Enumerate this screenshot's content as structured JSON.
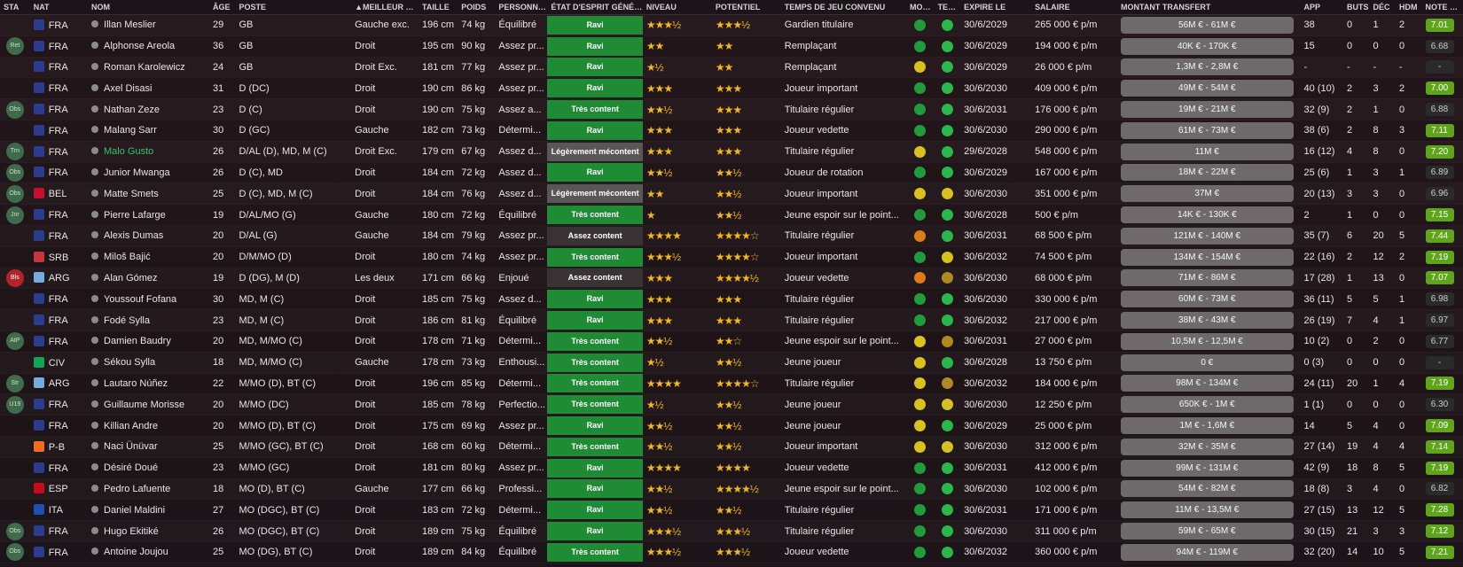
{
  "headers": [
    "STA",
    "NAT",
    "NOM",
    "ÂGE",
    "POSTE",
    "▲MEILLEUR PIED",
    "TAILLE",
    "POIDS",
    "PERSONNAL...",
    "ÉTAT D'ESPRIT GÉNÉRAL",
    "NIVEAU",
    "POTENTIEL",
    "TEMPS DE JEU CONVENU",
    "MOR...",
    "TEMP...",
    "EXPIRE LE",
    "SALAIRE",
    "MONTANT TRANSFERT",
    "APP",
    "BUTS",
    "DÉC",
    "HDM",
    "NOTE MOY"
  ],
  "rows": [
    {
      "sta": "",
      "nat": "FRA",
      "flag": "fra",
      "name": "Illan Meslier",
      "age": "29",
      "pos": "GB",
      "foot": "Gauche exc.",
      "height": "196 cm",
      "weight": "74 kg",
      "pers": "Équilibré",
      "mood": "Ravi",
      "moodc": "green",
      "niv": "★★★½",
      "pot": "★★★½",
      "pt": "Gardien titulaire",
      "morc": "g",
      "tempc": "g",
      "exp": "30/6/2029",
      "sal": "265 000 € p/m",
      "tv": "56M € - 61M €",
      "app": "38",
      "buts": "0",
      "dec": "1",
      "hdm": "2",
      "note": "7.01",
      "noteg": true
    },
    {
      "sta": "Ret",
      "nat": "FRA",
      "flag": "fra",
      "name": "Alphonse Areola",
      "age": "36",
      "pos": "GB",
      "foot": "Droit",
      "height": "195 cm",
      "weight": "90 kg",
      "pers": "Assez pr...",
      "mood": "Ravi",
      "moodc": "green",
      "niv": "★★",
      "pot": "★★",
      "pt": "Remplaçant",
      "morc": "g",
      "tempc": "g",
      "exp": "30/6/2029",
      "sal": "194 000 € p/m",
      "tv": "40K € - 170K €",
      "app": "15",
      "buts": "0",
      "dec": "0",
      "hdm": "0",
      "note": "6.68",
      "noteg": false
    },
    {
      "sta": "",
      "nat": "FRA",
      "flag": "fra",
      "name": "Roman Karolewicz",
      "age": "24",
      "pos": "GB",
      "foot": "Droit Exc.",
      "height": "181 cm",
      "weight": "77 kg",
      "pers": "Assez pr...",
      "mood": "Ravi",
      "moodc": "green",
      "niv": "★½",
      "pot": "★★",
      "pt": "Remplaçant",
      "morc": "y",
      "tempc": "g",
      "exp": "30/6/2029",
      "sal": "26 000 € p/m",
      "tv": "1,3M € - 2,8M €",
      "app": "-",
      "buts": "-",
      "dec": "-",
      "hdm": "-",
      "note": "-",
      "noteg": false
    },
    {
      "sta": "",
      "nat": "FRA",
      "flag": "fra",
      "name": "Axel Disasi",
      "age": "31",
      "pos": "D (DC)",
      "foot": "Droit",
      "height": "190 cm",
      "weight": "86 kg",
      "pers": "Assez pr...",
      "mood": "Ravi",
      "moodc": "green",
      "niv": "★★★",
      "pot": "★★★",
      "pt": "Joueur important",
      "morc": "g",
      "tempc": "g",
      "exp": "30/6/2030",
      "sal": "409 000 € p/m",
      "tv": "49M € - 54M €",
      "app": "40 (10)",
      "buts": "2",
      "dec": "3",
      "hdm": "2",
      "note": "7.00",
      "noteg": true
    },
    {
      "sta": "Obs",
      "nat": "FRA",
      "flag": "fra",
      "name": "Nathan Zeze",
      "age": "23",
      "pos": "D (C)",
      "foot": "Droit",
      "height": "190 cm",
      "weight": "75 kg",
      "pers": "Assez a...",
      "mood": "Très content",
      "moodc": "green",
      "niv": "★★½",
      "pot": "★★★",
      "pt": "Titulaire régulier",
      "morc": "g",
      "tempc": "g",
      "exp": "30/6/2031",
      "sal": "176 000 € p/m",
      "tv": "19M € - 21M €",
      "app": "32 (9)",
      "buts": "2",
      "dec": "1",
      "hdm": "0",
      "note": "6.88",
      "noteg": false
    },
    {
      "sta": "",
      "nat": "FRA",
      "flag": "fra",
      "name": "Malang Sarr",
      "age": "30",
      "pos": "D (GC)",
      "foot": "Gauche",
      "height": "182 cm",
      "weight": "73 kg",
      "pers": "Détermi...",
      "mood": "Ravi",
      "moodc": "green",
      "niv": "★★★",
      "pot": "★★★",
      "pt": "Joueur vedette",
      "morc": "g",
      "tempc": "g",
      "exp": "30/6/2030",
      "sal": "290 000 € p/m",
      "tv": "61M € - 73M €",
      "app": "38 (6)",
      "buts": "2",
      "dec": "8",
      "hdm": "3",
      "note": "7.11",
      "noteg": true
    },
    {
      "sta": "Trn",
      "nat": "FRA",
      "flag": "fra",
      "name": "Malo Gusto",
      "age": "26",
      "pos": "D/AL (D), MD, M (C)",
      "foot": "Droit Exc.",
      "height": "179 cm",
      "weight": "67 kg",
      "pers": "Assez d...",
      "mood": "Légèrement mécontent",
      "moodc": "grey",
      "niv": "★★★",
      "pot": "★★★",
      "pt": "Titulaire régulier",
      "morc": "y",
      "tempc": "g",
      "exp": "29/6/2028",
      "sal": "548 000 € p/m",
      "tv": "11M €",
      "app": "16 (12)",
      "buts": "4",
      "dec": "8",
      "hdm": "0",
      "note": "7.20",
      "noteg": true,
      "green": true
    },
    {
      "sta": "Obs",
      "nat": "FRA",
      "flag": "fra",
      "name": "Junior Mwanga",
      "age": "26",
      "pos": "D (C), MD",
      "foot": "Droit",
      "height": "184 cm",
      "weight": "72 kg",
      "pers": "Assez d...",
      "mood": "Ravi",
      "moodc": "green",
      "niv": "★★½",
      "pot": "★★½",
      "pt": "Joueur de rotation",
      "morc": "g",
      "tempc": "g",
      "exp": "30/6/2029",
      "sal": "167 000 € p/m",
      "tv": "18M € - 22M €",
      "app": "25 (6)",
      "buts": "1",
      "dec": "3",
      "hdm": "1",
      "note": "6.89",
      "noteg": false
    },
    {
      "sta": "Obs",
      "nat": "BEL",
      "flag": "bel",
      "name": "Matte Smets",
      "age": "25",
      "pos": "D (C), MD, M (C)",
      "foot": "Droit",
      "height": "184 cm",
      "weight": "76 kg",
      "pers": "Assez d...",
      "mood": "Légèrement mécontent",
      "moodc": "grey",
      "niv": "★★",
      "pot": "★★½",
      "pt": "Joueur important",
      "morc": "y",
      "tempc": "y",
      "exp": "30/6/2030",
      "sal": "351 000 € p/m",
      "tv": "37M €",
      "app": "20 (13)",
      "buts": "3",
      "dec": "3",
      "hdm": "0",
      "note": "6.96",
      "noteg": false
    },
    {
      "sta": "Jnr",
      "nat": "FRA",
      "flag": "fra",
      "name": "Pierre Lafarge",
      "age": "19",
      "pos": "D/AL/MO (G)",
      "foot": "Gauche",
      "height": "180 cm",
      "weight": "72 kg",
      "pers": "Équilibré",
      "mood": "Très content",
      "moodc": "green",
      "niv": "★",
      "pot": "★★½",
      "pt": "Jeune espoir sur le point...",
      "morc": "g",
      "tempc": "g",
      "exp": "30/6/2028",
      "sal": "500 € p/m",
      "tv": "14K € - 130K €",
      "app": "2",
      "buts": "1",
      "dec": "0",
      "hdm": "0",
      "note": "7.15",
      "noteg": true
    },
    {
      "sta": "",
      "nat": "FRA",
      "flag": "fra",
      "name": "Alexis Dumas",
      "age": "20",
      "pos": "D/AL (G)",
      "foot": "Gauche",
      "height": "184 cm",
      "weight": "79 kg",
      "pers": "Assez pr...",
      "mood": "Assez content",
      "moodc": "dark",
      "niv": "★★★★",
      "pot": "★★★★☆",
      "pt": "Titulaire régulier",
      "morc": "o",
      "tempc": "g",
      "exp": "30/6/2031",
      "sal": "68 500 € p/m",
      "tv": "121M € - 140M €",
      "app": "35 (7)",
      "buts": "6",
      "dec": "20",
      "hdm": "5",
      "note": "7.44",
      "noteg": true
    },
    {
      "sta": "",
      "nat": "SRB",
      "flag": "srb",
      "name": "Miloš Bajić",
      "age": "20",
      "pos": "D/M/MO (D)",
      "foot": "Droit",
      "height": "180 cm",
      "weight": "74 kg",
      "pers": "Assez pr...",
      "mood": "Très content",
      "moodc": "green",
      "niv": "★★★½",
      "pot": "★★★★☆",
      "pt": "Joueur important",
      "morc": "g",
      "tempc": "y",
      "exp": "30/6/2032",
      "sal": "74 500 € p/m",
      "tv": "134M € - 154M €",
      "app": "22 (16)",
      "buts": "2",
      "dec": "12",
      "hdm": "2",
      "note": "7.19",
      "noteg": true
    },
    {
      "sta": "Bls",
      "nat": "ARG",
      "flag": "arg",
      "name": "Alan Gómez",
      "age": "19",
      "pos": "D (DG), M (D)",
      "foot": "Les deux",
      "height": "171 cm",
      "weight": "66 kg",
      "pers": "Enjoué",
      "mood": "Assez content",
      "moodc": "dark",
      "niv": "★★★",
      "pot": "★★★★½",
      "pt": "Joueur vedette",
      "morc": "o",
      "tempc": "gd",
      "exp": "30/6/2030",
      "sal": "68 000 € p/m",
      "tv": "71M € - 86M €",
      "app": "17 (28)",
      "buts": "1",
      "dec": "13",
      "hdm": "0",
      "note": "7.07",
      "noteg": true,
      "red": true
    },
    {
      "sta": "",
      "nat": "FRA",
      "flag": "fra",
      "name": "Youssouf Fofana",
      "age": "30",
      "pos": "MD, M (C)",
      "foot": "Droit",
      "height": "185 cm",
      "weight": "75 kg",
      "pers": "Assez d...",
      "mood": "Ravi",
      "moodc": "green",
      "niv": "★★★",
      "pot": "★★★",
      "pt": "Titulaire régulier",
      "morc": "g",
      "tempc": "g",
      "exp": "30/6/2030",
      "sal": "330 000 € p/m",
      "tv": "60M € - 73M €",
      "app": "36 (11)",
      "buts": "5",
      "dec": "5",
      "hdm": "1",
      "note": "6.98",
      "noteg": false
    },
    {
      "sta": "",
      "nat": "FRA",
      "flag": "fra",
      "name": "Fodé Sylla",
      "age": "23",
      "pos": "MD, M (C)",
      "foot": "Droit",
      "height": "186 cm",
      "weight": "81 kg",
      "pers": "Équilibré",
      "mood": "Ravi",
      "moodc": "green",
      "niv": "★★★",
      "pot": "★★★",
      "pt": "Titulaire régulier",
      "morc": "g",
      "tempc": "g",
      "exp": "30/6/2032",
      "sal": "217 000 € p/m",
      "tv": "38M € - 43M €",
      "app": "26 (19)",
      "buts": "7",
      "dec": "4",
      "hdm": "1",
      "note": "6.97",
      "noteg": false
    },
    {
      "sta": "AtP",
      "nat": "FRA",
      "flag": "fra",
      "name": "Damien Baudry",
      "age": "20",
      "pos": "MD, M/MO (C)",
      "foot": "Droit",
      "height": "178 cm",
      "weight": "71 kg",
      "pers": "Détermi...",
      "mood": "Très content",
      "moodc": "green",
      "niv": "★★½",
      "pot": "★★☆",
      "pt": "Jeune espoir sur le point...",
      "morc": "y",
      "tempc": "gd",
      "exp": "30/6/2031",
      "sal": "27 000 € p/m",
      "tv": "10,5M € - 12,5M €",
      "app": "10 (2)",
      "buts": "0",
      "dec": "2",
      "hdm": "0",
      "note": "6.77",
      "noteg": false
    },
    {
      "sta": "",
      "nat": "CIV",
      "flag": "civ",
      "name": "Sékou Sylla",
      "age": "18",
      "pos": "MD, M/MO (C)",
      "foot": "Gauche",
      "height": "178 cm",
      "weight": "73 kg",
      "pers": "Enthousi...",
      "mood": "Très content",
      "moodc": "green",
      "niv": "★½",
      "pot": "★★½",
      "pt": "Jeune joueur",
      "morc": "y",
      "tempc": "g",
      "exp": "30/6/2028",
      "sal": "13 750 € p/m",
      "tv": "0 €",
      "app": "0 (3)",
      "buts": "0",
      "dec": "0",
      "hdm": "0",
      "note": "-",
      "noteg": false
    },
    {
      "sta": "Str",
      "nat": "ARG",
      "flag": "arg",
      "name": "Lautaro Núñez",
      "age": "22",
      "pos": "M/MO (D), BT (C)",
      "foot": "Droit",
      "height": "196 cm",
      "weight": "85 kg",
      "pers": "Détermi...",
      "mood": "Très content",
      "moodc": "green",
      "niv": "★★★★",
      "pot": "★★★★☆",
      "pt": "Titulaire régulier",
      "morc": "y",
      "tempc": "gd",
      "exp": "30/6/2032",
      "sal": "184 000 € p/m",
      "tv": "98M € - 134M €",
      "app": "24 (11)",
      "buts": "20",
      "dec": "1",
      "hdm": "4",
      "note": "7.19",
      "noteg": true
    },
    {
      "sta": "U19",
      "nat": "FRA",
      "flag": "fra",
      "name": "Guillaume Morisse",
      "age": "20",
      "pos": "M/MO (DC)",
      "foot": "Droit",
      "height": "185 cm",
      "weight": "78 kg",
      "pers": "Perfectio...",
      "mood": "Très content",
      "moodc": "green",
      "niv": "★½",
      "pot": "★★½",
      "pt": "Jeune joueur",
      "morc": "y",
      "tempc": "y",
      "exp": "30/6/2030",
      "sal": "12 250 € p/m",
      "tv": "650K € - 1M €",
      "app": "1 (1)",
      "buts": "0",
      "dec": "0",
      "hdm": "0",
      "note": "6.30",
      "noteg": false
    },
    {
      "sta": "",
      "nat": "FRA",
      "flag": "fra",
      "name": "Killian Andre",
      "age": "20",
      "pos": "M/MO (D), BT (C)",
      "foot": "Droit",
      "height": "175 cm",
      "weight": "69 kg",
      "pers": "Assez pr...",
      "mood": "Ravi",
      "moodc": "green",
      "niv": "★★½",
      "pot": "★★½",
      "pt": "Jeune joueur",
      "morc": "y",
      "tempc": "g",
      "exp": "30/6/2029",
      "sal": "25 000 € p/m",
      "tv": "1M € - 1,6M €",
      "app": "14",
      "buts": "5",
      "dec": "4",
      "hdm": "0",
      "note": "7.09",
      "noteg": true
    },
    {
      "sta": "",
      "nat": "P-B",
      "flag": "ned",
      "name": "Naci Ünüvar",
      "age": "25",
      "pos": "M/MO (GC), BT (C)",
      "foot": "Droit",
      "height": "168 cm",
      "weight": "60 kg",
      "pers": "Détermi...",
      "mood": "Très content",
      "moodc": "green",
      "niv": "★★½",
      "pot": "★★½",
      "pt": "Joueur important",
      "morc": "y",
      "tempc": "y",
      "exp": "30/6/2030",
      "sal": "312 000 € p/m",
      "tv": "32M € - 35M €",
      "app": "27 (14)",
      "buts": "19",
      "dec": "4",
      "hdm": "4",
      "note": "7.14",
      "noteg": true
    },
    {
      "sta": "",
      "nat": "FRA",
      "flag": "fra",
      "name": "Désiré Doué",
      "age": "23",
      "pos": "M/MO (GC)",
      "foot": "Droit",
      "height": "181 cm",
      "weight": "80 kg",
      "pers": "Assez pr...",
      "mood": "Ravi",
      "moodc": "green",
      "niv": "★★★★",
      "pot": "★★★★",
      "pt": "Joueur vedette",
      "morc": "g",
      "tempc": "g",
      "exp": "30/6/2031",
      "sal": "412 000 € p/m",
      "tv": "99M € - 131M €",
      "app": "42 (9)",
      "buts": "18",
      "dec": "8",
      "hdm": "5",
      "note": "7.19",
      "noteg": true
    },
    {
      "sta": "",
      "nat": "ESP",
      "flag": "esp",
      "name": "Pedro Lafuente",
      "age": "18",
      "pos": "MO (D), BT (C)",
      "foot": "Gauche",
      "height": "177 cm",
      "weight": "66 kg",
      "pers": "Professi...",
      "mood": "Ravi",
      "moodc": "green",
      "niv": "★★½",
      "pot": "★★★★½",
      "pt": "Jeune espoir sur le point...",
      "morc": "g",
      "tempc": "g",
      "exp": "30/6/2030",
      "sal": "102 000 € p/m",
      "tv": "54M € - 82M €",
      "app": "18 (8)",
      "buts": "3",
      "dec": "4",
      "hdm": "0",
      "note": "6.82",
      "noteg": false
    },
    {
      "sta": "",
      "nat": "ITA",
      "flag": "ita",
      "name": "Daniel Maldini",
      "age": "27",
      "pos": "MO (DGC), BT (C)",
      "foot": "Droit",
      "height": "183 cm",
      "weight": "72 kg",
      "pers": "Détermi...",
      "mood": "Ravi",
      "moodc": "green",
      "niv": "★★½",
      "pot": "★★½",
      "pt": "Titulaire régulier",
      "morc": "g",
      "tempc": "g",
      "exp": "30/6/2031",
      "sal": "171 000 € p/m",
      "tv": "11M € - 13,5M €",
      "app": "27 (15)",
      "buts": "13",
      "dec": "12",
      "hdm": "5",
      "note": "7.28",
      "noteg": true
    },
    {
      "sta": "Obs",
      "nat": "FRA",
      "flag": "fra",
      "name": "Hugo Ekitiké",
      "age": "26",
      "pos": "MO (DGC), BT (C)",
      "foot": "Droit",
      "height": "189 cm",
      "weight": "75 kg",
      "pers": "Équilibré",
      "mood": "Ravi",
      "moodc": "green",
      "niv": "★★★½",
      "pot": "★★★½",
      "pt": "Titulaire régulier",
      "morc": "g",
      "tempc": "g",
      "exp": "30/6/2030",
      "sal": "311 000 € p/m",
      "tv": "59M € - 65M €",
      "app": "30 (15)",
      "buts": "21",
      "dec": "3",
      "hdm": "3",
      "note": "7.12",
      "noteg": true
    },
    {
      "sta": "Obs",
      "nat": "FRA",
      "flag": "fra",
      "name": "Antoine Joujou",
      "age": "25",
      "pos": "MO (DG), BT (C)",
      "foot": "Droit",
      "height": "189 cm",
      "weight": "84 kg",
      "pers": "Équilibré",
      "mood": "Très content",
      "moodc": "green",
      "niv": "★★★½",
      "pot": "★★★½",
      "pt": "Joueur vedette",
      "morc": "g",
      "tempc": "g",
      "exp": "30/6/2032",
      "sal": "360 000 € p/m",
      "tv": "94M € - 119M €",
      "app": "32 (20)",
      "buts": "14",
      "dec": "10",
      "hdm": "5",
      "note": "7.21",
      "noteg": true
    }
  ]
}
